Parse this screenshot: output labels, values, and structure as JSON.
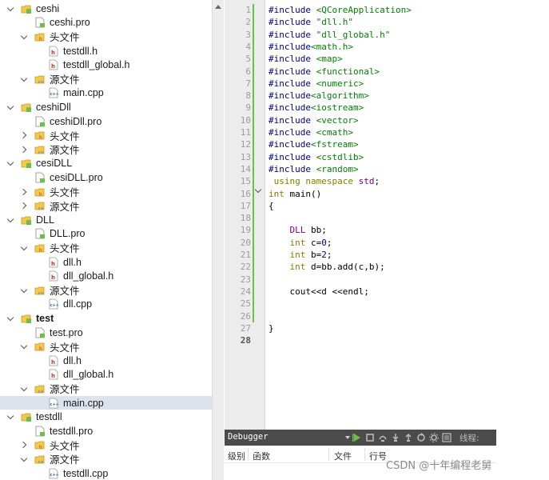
{
  "tree": [
    {
      "label": "ceshi",
      "level": 0,
      "arrow": "down",
      "icon": "project-icon",
      "bold": false,
      "selected": false
    },
    {
      "label": "ceshi.pro",
      "level": 1,
      "arrow": "none",
      "icon": "pro-file-icon",
      "bold": false,
      "selected": false
    },
    {
      "label": "头文件",
      "level": 1,
      "arrow": "down",
      "icon": "header-folder-icon",
      "bold": false,
      "selected": false
    },
    {
      "label": "testdll.h",
      "level": 2,
      "arrow": "none",
      "icon": "h-file-icon",
      "bold": false,
      "selected": false
    },
    {
      "label": "testdll_global.h",
      "level": 2,
      "arrow": "none",
      "icon": "h-file-icon",
      "bold": false,
      "selected": false
    },
    {
      "label": "源文件",
      "level": 1,
      "arrow": "down",
      "icon": "source-folder-icon",
      "bold": false,
      "selected": false
    },
    {
      "label": "main.cpp",
      "level": 2,
      "arrow": "none",
      "icon": "cpp-file-icon",
      "bold": false,
      "selected": false
    },
    {
      "label": "ceshiDll",
      "level": 0,
      "arrow": "down",
      "icon": "project-icon",
      "bold": false,
      "selected": false
    },
    {
      "label": "ceshiDll.pro",
      "level": 1,
      "arrow": "none",
      "icon": "pro-file-icon",
      "bold": false,
      "selected": false
    },
    {
      "label": "头文件",
      "level": 1,
      "arrow": "right",
      "icon": "header-folder-icon",
      "bold": false,
      "selected": false
    },
    {
      "label": "源文件",
      "level": 1,
      "arrow": "right",
      "icon": "source-folder-icon",
      "bold": false,
      "selected": false
    },
    {
      "label": "cesiDLL",
      "level": 0,
      "arrow": "down",
      "icon": "project-icon",
      "bold": false,
      "selected": false
    },
    {
      "label": "cesiDLL.pro",
      "level": 1,
      "arrow": "none",
      "icon": "pro-file-icon",
      "bold": false,
      "selected": false
    },
    {
      "label": "头文件",
      "level": 1,
      "arrow": "right",
      "icon": "header-folder-icon",
      "bold": false,
      "selected": false
    },
    {
      "label": "源文件",
      "level": 1,
      "arrow": "right",
      "icon": "source-folder-icon",
      "bold": false,
      "selected": false
    },
    {
      "label": "DLL",
      "level": 0,
      "arrow": "down",
      "icon": "project-icon",
      "bold": false,
      "selected": false
    },
    {
      "label": "DLL.pro",
      "level": 1,
      "arrow": "none",
      "icon": "pro-file-icon",
      "bold": false,
      "selected": false
    },
    {
      "label": "头文件",
      "level": 1,
      "arrow": "down",
      "icon": "header-folder-icon",
      "bold": false,
      "selected": false
    },
    {
      "label": "dll.h",
      "level": 2,
      "arrow": "none",
      "icon": "h-file-icon",
      "bold": false,
      "selected": false
    },
    {
      "label": "dll_global.h",
      "level": 2,
      "arrow": "none",
      "icon": "h-file-icon",
      "bold": false,
      "selected": false
    },
    {
      "label": "源文件",
      "level": 1,
      "arrow": "down",
      "icon": "source-folder-icon",
      "bold": false,
      "selected": false
    },
    {
      "label": "dll.cpp",
      "level": 2,
      "arrow": "none",
      "icon": "cpp-file-icon",
      "bold": false,
      "selected": false
    },
    {
      "label": "test",
      "level": 0,
      "arrow": "down",
      "icon": "project-icon",
      "bold": true,
      "selected": false
    },
    {
      "label": "test.pro",
      "level": 1,
      "arrow": "none",
      "icon": "pro-file-icon",
      "bold": false,
      "selected": false
    },
    {
      "label": "头文件",
      "level": 1,
      "arrow": "down",
      "icon": "header-folder-icon",
      "bold": false,
      "selected": false
    },
    {
      "label": "dll.h",
      "level": 2,
      "arrow": "none",
      "icon": "h-file-icon",
      "bold": false,
      "selected": false
    },
    {
      "label": "dll_global.h",
      "level": 2,
      "arrow": "none",
      "icon": "h-file-icon",
      "bold": false,
      "selected": false
    },
    {
      "label": "源文件",
      "level": 1,
      "arrow": "down",
      "icon": "source-folder-icon",
      "bold": false,
      "selected": false
    },
    {
      "label": "main.cpp",
      "level": 2,
      "arrow": "none",
      "icon": "cpp-file-icon",
      "bold": false,
      "selected": true
    },
    {
      "label": "testdll",
      "level": 0,
      "arrow": "down",
      "icon": "project-icon",
      "bold": false,
      "selected": false
    },
    {
      "label": "testdll.pro",
      "level": 1,
      "arrow": "none",
      "icon": "pro-file-icon",
      "bold": false,
      "selected": false
    },
    {
      "label": "头文件",
      "level": 1,
      "arrow": "right",
      "icon": "header-folder-icon",
      "bold": false,
      "selected": false
    },
    {
      "label": "源文件",
      "level": 1,
      "arrow": "down",
      "icon": "source-folder-icon",
      "bold": false,
      "selected": false
    },
    {
      "label": "testdll.cpp",
      "level": 2,
      "arrow": "none",
      "icon": "cpp-file-icon",
      "bold": false,
      "selected": false
    }
  ],
  "editor": {
    "current_line": 28,
    "modified_lines": [
      1,
      2,
      3,
      4,
      5,
      6,
      7,
      8,
      9,
      10,
      11,
      12,
      13,
      14,
      15,
      16,
      17,
      18,
      19,
      20,
      21,
      22,
      23,
      24,
      25,
      26
    ],
    "lines": [
      {
        "n": "1",
        "indent": "",
        "tokens": [
          {
            "t": "#include",
            "c": "pp"
          },
          {
            "t": " ",
            "c": ""
          },
          {
            "t": "<QCoreApplication>",
            "c": "inc"
          }
        ]
      },
      {
        "n": "2",
        "indent": "",
        "tokens": [
          {
            "t": "#include",
            "c": "pp"
          },
          {
            "t": " ",
            "c": ""
          },
          {
            "t": "\"dll.h\"",
            "c": "inc"
          }
        ]
      },
      {
        "n": "3",
        "indent": "",
        "tokens": [
          {
            "t": "#include",
            "c": "pp"
          },
          {
            "t": " ",
            "c": ""
          },
          {
            "t": "\"dll_global.h\"",
            "c": "inc"
          }
        ]
      },
      {
        "n": "4",
        "indent": "",
        "tokens": [
          {
            "t": "#include",
            "c": "pp"
          },
          {
            "t": "<math.h>",
            "c": "inc"
          }
        ]
      },
      {
        "n": "5",
        "indent": "",
        "tokens": [
          {
            "t": "#include",
            "c": "pp"
          },
          {
            "t": " ",
            "c": ""
          },
          {
            "t": "<map>",
            "c": "inc"
          }
        ]
      },
      {
        "n": "6",
        "indent": "",
        "tokens": [
          {
            "t": "#include",
            "c": "pp"
          },
          {
            "t": " ",
            "c": ""
          },
          {
            "t": "<functional>",
            "c": "inc"
          }
        ]
      },
      {
        "n": "7",
        "indent": "",
        "tokens": [
          {
            "t": "#include",
            "c": "pp"
          },
          {
            "t": " ",
            "c": ""
          },
          {
            "t": "<numeric>",
            "c": "inc"
          }
        ]
      },
      {
        "n": "8",
        "indent": "",
        "tokens": [
          {
            "t": "#include",
            "c": "pp"
          },
          {
            "t": "<algorithm>",
            "c": "inc"
          }
        ]
      },
      {
        "n": "9",
        "indent": "",
        "tokens": [
          {
            "t": "#include",
            "c": "pp"
          },
          {
            "t": "<iostream>",
            "c": "inc"
          }
        ]
      },
      {
        "n": "10",
        "indent": "",
        "tokens": [
          {
            "t": "#include",
            "c": "pp"
          },
          {
            "t": " ",
            "c": ""
          },
          {
            "t": "<vector>",
            "c": "inc"
          }
        ]
      },
      {
        "n": "11",
        "indent": "",
        "tokens": [
          {
            "t": "#include",
            "c": "pp"
          },
          {
            "t": " ",
            "c": ""
          },
          {
            "t": "<cmath>",
            "c": "inc"
          }
        ]
      },
      {
        "n": "12",
        "indent": "",
        "tokens": [
          {
            "t": "#include",
            "c": "pp"
          },
          {
            "t": "<fstream>",
            "c": "inc"
          }
        ]
      },
      {
        "n": "13",
        "indent": "",
        "tokens": [
          {
            "t": "#include",
            "c": "pp"
          },
          {
            "t": " ",
            "c": ""
          },
          {
            "t": "<cstdlib>",
            "c": "inc"
          }
        ]
      },
      {
        "n": "14",
        "indent": "",
        "tokens": [
          {
            "t": "#include",
            "c": "pp"
          },
          {
            "t": " ",
            "c": ""
          },
          {
            "t": "<random>",
            "c": "inc"
          }
        ]
      },
      {
        "n": "15",
        "indent": " ",
        "tokens": [
          {
            "t": "using",
            "c": "kw"
          },
          {
            "t": " ",
            "c": ""
          },
          {
            "t": "namespace",
            "c": "kw"
          },
          {
            "t": " ",
            "c": ""
          },
          {
            "t": "std",
            "c": "ty"
          },
          {
            "t": ";",
            "c": ""
          }
        ]
      },
      {
        "n": "16",
        "indent": "",
        "tokens": [
          {
            "t": "int",
            "c": "kw"
          },
          {
            "t": " main()",
            "c": ""
          }
        ]
      },
      {
        "n": "17",
        "indent": "",
        "tokens": [
          {
            "t": "{",
            "c": ""
          }
        ]
      },
      {
        "n": "18",
        "indent": "",
        "tokens": []
      },
      {
        "n": "19",
        "indent": "    ",
        "tokens": [
          {
            "t": "DLL",
            "c": "ty"
          },
          {
            "t": " bb;",
            "c": ""
          }
        ]
      },
      {
        "n": "20",
        "indent": "    ",
        "tokens": [
          {
            "t": "int",
            "c": "kw"
          },
          {
            "t": " c=",
            "c": ""
          },
          {
            "t": "0",
            "c": "num"
          },
          {
            "t": ";",
            "c": ""
          }
        ]
      },
      {
        "n": "21",
        "indent": "    ",
        "tokens": [
          {
            "t": "int",
            "c": "kw"
          },
          {
            "t": " b=",
            "c": ""
          },
          {
            "t": "2",
            "c": "num"
          },
          {
            "t": ";",
            "c": ""
          }
        ]
      },
      {
        "n": "22",
        "indent": "    ",
        "tokens": [
          {
            "t": "int",
            "c": "kw"
          },
          {
            "t": " d=bb.add(c,b);",
            "c": ""
          }
        ]
      },
      {
        "n": "23",
        "indent": "",
        "tokens": []
      },
      {
        "n": "24",
        "indent": "    ",
        "tokens": [
          {
            "t": "cout<<d <<endl;",
            "c": ""
          }
        ]
      },
      {
        "n": "25",
        "indent": "",
        "tokens": []
      },
      {
        "n": "26",
        "indent": "",
        "tokens": []
      },
      {
        "n": "27",
        "indent": "",
        "tokens": [
          {
            "t": "}",
            "c": ""
          }
        ]
      },
      {
        "n": "28",
        "indent": "",
        "tokens": []
      }
    ]
  },
  "debugger": {
    "title": "Debugger",
    "thread_label": "线程:",
    "columns": [
      "级别",
      "函数",
      "文件",
      "行号"
    ]
  },
  "watermark": "CSDN @十年编程老舅"
}
